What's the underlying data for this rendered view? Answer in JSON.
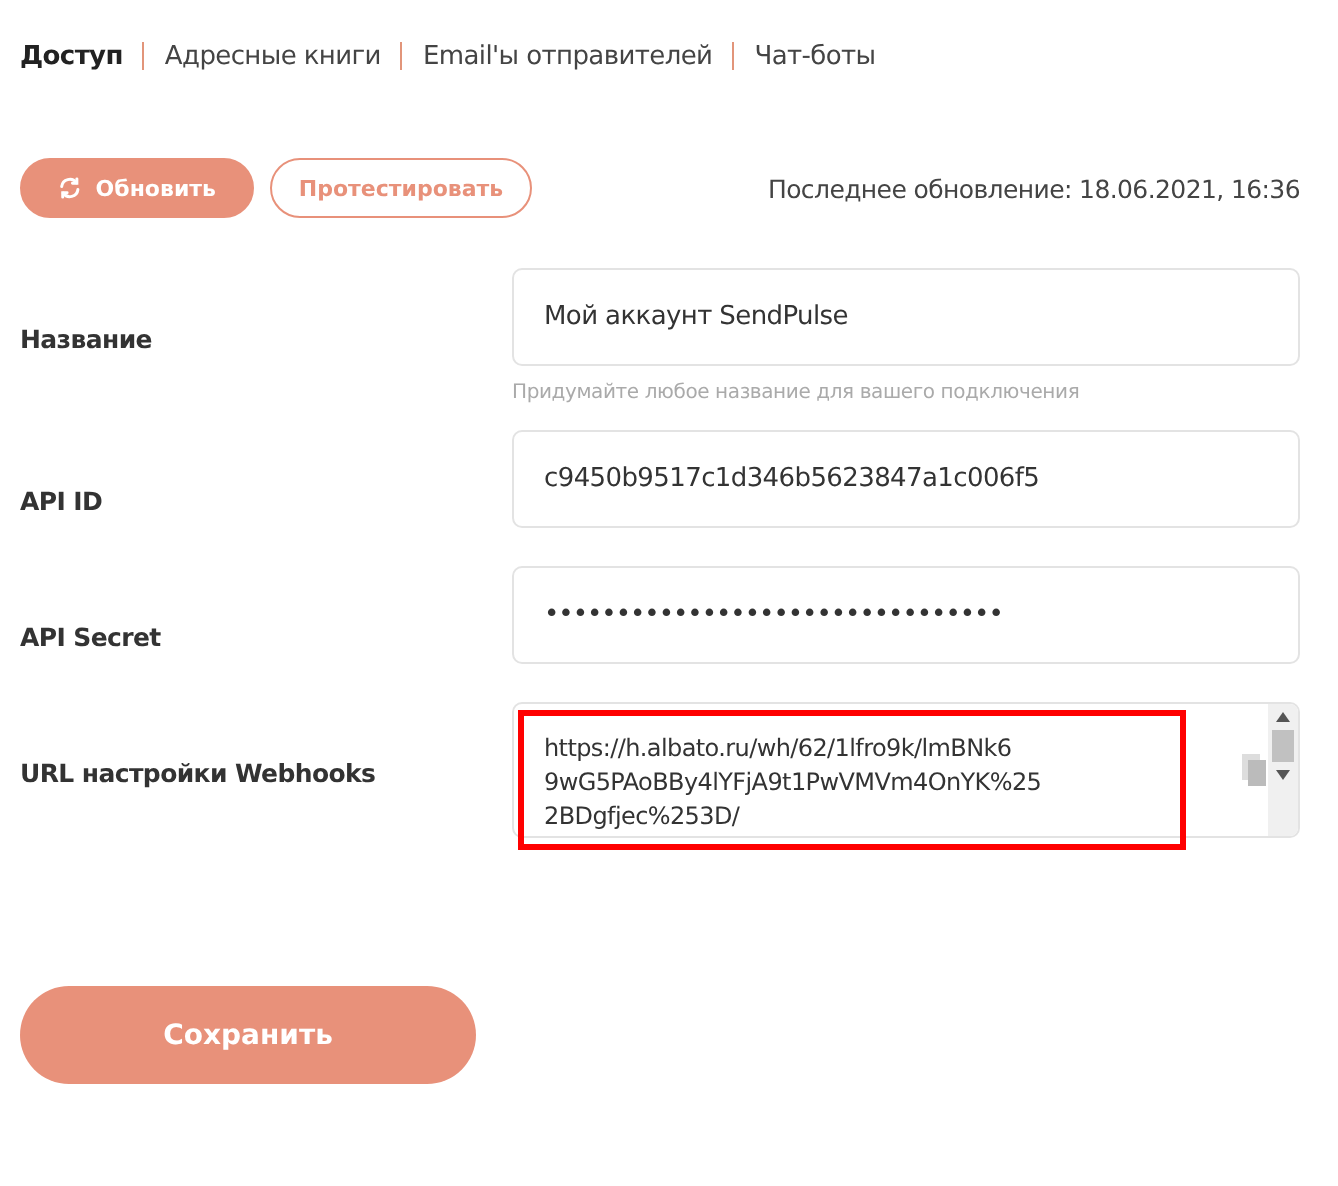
{
  "tabs": [
    {
      "label": "Доступ",
      "selected": true
    },
    {
      "label": "Адресные книги",
      "selected": false
    },
    {
      "label": "Email'ы отправителей",
      "selected": false
    },
    {
      "label": "Чат-боты",
      "selected": false
    }
  ],
  "actions": {
    "refresh": "Обновить",
    "test": "Протестировать",
    "last_update": "Последнее обновление: 18.06.2021, 16:36"
  },
  "fields": [
    {
      "kind": "text",
      "label": "Название",
      "value": "Мой аккаунт SendPulse",
      "hint": "Придумайте любое название для вашего подключения"
    },
    {
      "kind": "text",
      "label": "API ID",
      "value": "c9450b9517c1d346b5623847a1c006f5"
    },
    {
      "kind": "password",
      "label": "API Secret",
      "value": "••••••••••••••••••••••••••••••••"
    },
    {
      "kind": "textarea",
      "label": "URL настройки Webhooks",
      "value_lines": [
        "https://h.albato.ru/wh/62/1lfro9k/lmBNk6",
        "9wG5PAoBBy4lYFjA9t1PwVMVm4OnYK%25",
        "2BDgfjec%253D/"
      ],
      "highlighted": true
    }
  ],
  "save_button": "Сохранить"
}
